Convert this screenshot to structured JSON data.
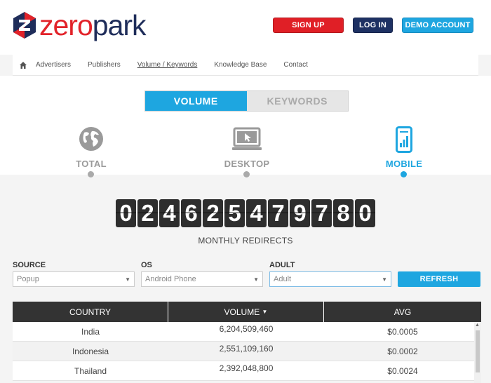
{
  "logo": {
    "text_red": "zero",
    "text_blue": "park"
  },
  "header": {
    "signup": "SIGN UP",
    "login": "LOG IN",
    "demo": "DEMO ACCOUNT"
  },
  "nav": {
    "items": [
      "Advertisers",
      "Publishers",
      "Volume / Keywords",
      "Knowledge Base",
      "Contact"
    ]
  },
  "toggle": {
    "volume": "VOLUME",
    "keywords": "KEYWORDS",
    "selected": "VOLUME"
  },
  "devices": [
    {
      "label": "TOTAL",
      "icon": "globe-icon"
    },
    {
      "label": "DESKTOP",
      "icon": "desktop-icon"
    },
    {
      "label": "MOBILE",
      "icon": "mobile-icon",
      "active": true
    }
  ],
  "counter": {
    "digits": [
      "0",
      "2",
      "4",
      "6",
      "2",
      "5",
      "4",
      "7",
      "9",
      "7",
      "8",
      "0"
    ],
    "label": "MONTHLY REDIRECTS"
  },
  "filters": {
    "source": {
      "label": "SOURCE",
      "value": "Popup"
    },
    "os": {
      "label": "OS",
      "value": "Android Phone"
    },
    "adult": {
      "label": "ADULT",
      "value": "Adult"
    },
    "refresh": "REFRESH"
  },
  "table": {
    "columns": [
      "COUNTRY",
      "VOLUME",
      "AVG"
    ],
    "sort_indicator": "▼",
    "rows": [
      {
        "country": "India",
        "volume": "6,204,509,460",
        "avg": "$0.0005"
      },
      {
        "country": "Indonesia",
        "volume": "2,551,109,160",
        "avg": "$0.0002"
      },
      {
        "country": "Thailand",
        "volume": "2,392,048,800",
        "avg": "$0.0024"
      }
    ]
  },
  "colors": {
    "accent": "#1ea6e0",
    "brand_red": "#e2232a",
    "brand_navy": "#1f2d5a",
    "signup": "#e01f26"
  }
}
